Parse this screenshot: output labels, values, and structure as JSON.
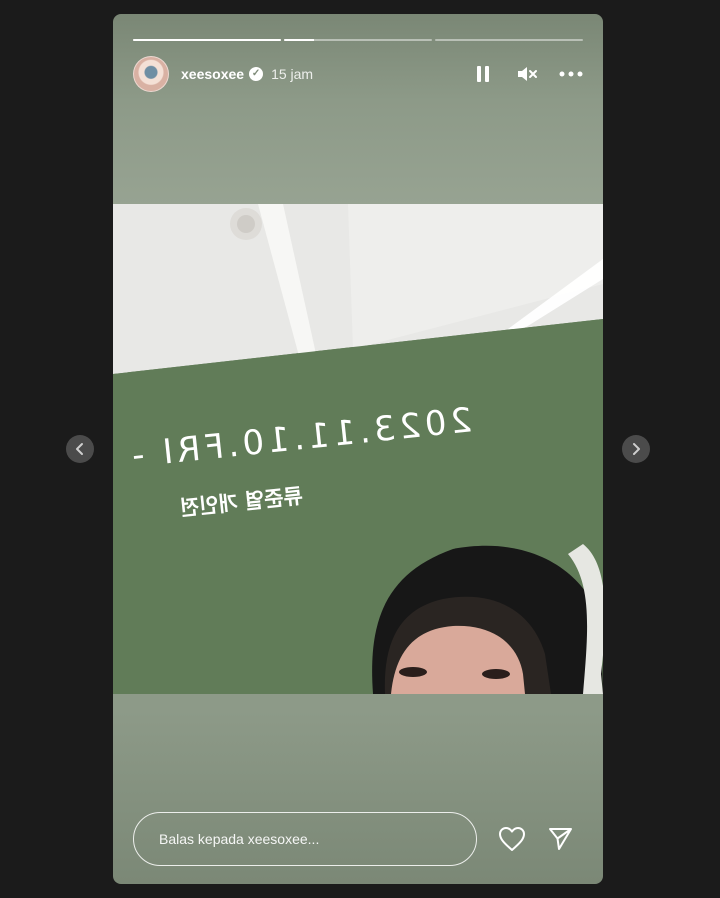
{
  "story": {
    "progress": [
      1.0,
      0.2,
      0.0
    ],
    "user": {
      "name": "xeesoxee",
      "time": "15 jam",
      "avatar_icon": "profile-eye-photo",
      "verified_icon": "verified-check-icon"
    },
    "controls": {
      "pause_icon": "pause-icon",
      "mute_icon": "mute-icon",
      "more_icon": "more-icon"
    },
    "photo": {
      "date_text": "2023.11.10.FRI -",
      "korean_text": "류준열 개인전"
    },
    "reply": {
      "placeholder": "Balas kepada xeesoxee..."
    },
    "icons": {
      "like": "heart-icon",
      "share": "send-icon"
    }
  },
  "nav": {
    "prev_icon": "chevron-left-icon",
    "next_icon": "chevron-right-icon"
  },
  "colors": {
    "background": "#1b1b1b",
    "story_bg": "#8d9a88",
    "wall": "#617c58"
  }
}
